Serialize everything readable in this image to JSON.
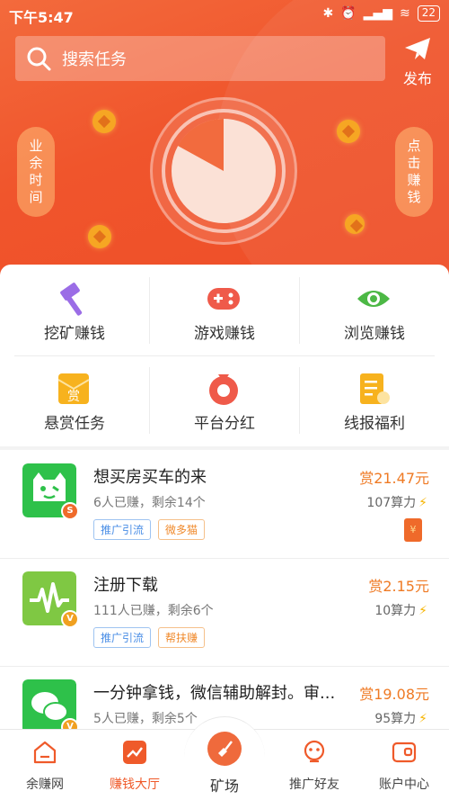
{
  "status_bar": {
    "time": "下午5:47",
    "battery": "22"
  },
  "search": {
    "placeholder": "搜索任务"
  },
  "publish": {
    "label": "发布"
  },
  "side_left": {
    "label": "业余时间"
  },
  "side_right": {
    "label": "点击赚钱"
  },
  "menu": [
    {
      "label": "挖矿赚钱",
      "icon": "hammer-icon",
      "color": "#9b6de6"
    },
    {
      "label": "游戏赚钱",
      "icon": "gamepad-icon",
      "color": "#ef5a4a"
    },
    {
      "label": "浏览赚钱",
      "icon": "eye-icon",
      "color": "#4cb845"
    },
    {
      "label": "悬赏任务",
      "icon": "reward-envelope-icon",
      "color": "#f7b21e"
    },
    {
      "label": "平台分红",
      "icon": "money-bag-icon",
      "color": "#ef5a4a"
    },
    {
      "label": "线报福利",
      "icon": "clipboard-icon",
      "color": "#f7b21e"
    }
  ],
  "tasks": [
    {
      "title": "想买房买车的来",
      "stats": "6人已赚，剩余14个",
      "reward": "赏21.47元",
      "power": "107算力",
      "tags": [
        "推广引流",
        "微多猫"
      ],
      "avatar_color": "#2ec14a",
      "badge": "S",
      "badge_color": "#ef6a2a"
    },
    {
      "title": "注册下载",
      "stats": "111人已赚，剩余6个",
      "reward": "赏2.15元",
      "power": "10算力",
      "tags": [
        "推广引流",
        "帮扶赚"
      ],
      "avatar_color": "#7fc843",
      "badge": "V",
      "badge_color": "#f0a020"
    },
    {
      "title": "一分钟拿钱，微信辅助解封。审...",
      "stats": "5人已赚，剩余5个",
      "reward": "赏19.08元",
      "power": "95算力",
      "tags": [],
      "avatar_color": "#2ec14a",
      "badge": "V",
      "badge_color": "#f0a020"
    }
  ],
  "tabbar": [
    {
      "label": "余赚网",
      "icon": "home-icon"
    },
    {
      "label": "赚钱大厅",
      "icon": "trend-icon"
    },
    {
      "label": "矿场",
      "icon": "shovel-icon"
    },
    {
      "label": "推广好友",
      "icon": "mascot-icon"
    },
    {
      "label": "账户中心",
      "icon": "wallet-icon"
    }
  ],
  "colors": {
    "accent": "#f0552c",
    "reward": "#ef7a24"
  }
}
